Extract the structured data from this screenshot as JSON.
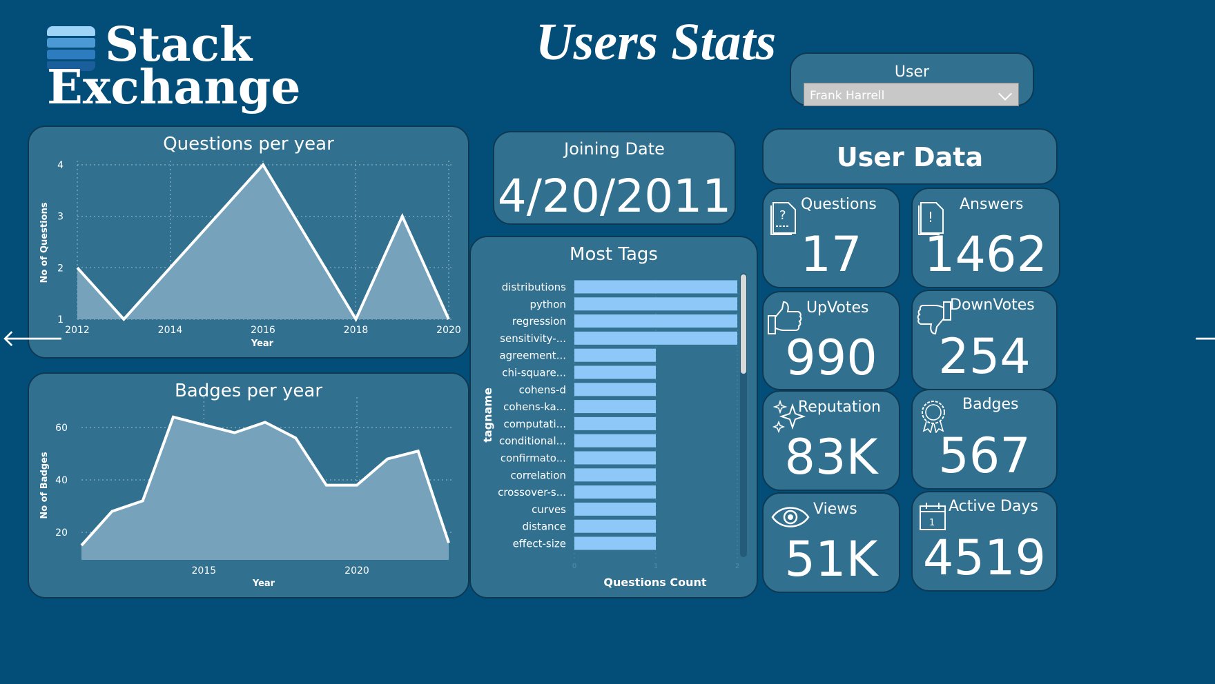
{
  "header": {
    "logo_line1": "Stack",
    "logo_line2": "Exchange",
    "title": "Users Stats"
  },
  "slicer": {
    "label": "User",
    "selected": "Frank Harrell"
  },
  "joining": {
    "label": "Joining Date",
    "value": "4/20/2011"
  },
  "user_data": {
    "title": "User Data",
    "kpis": {
      "questions": {
        "label": "Questions",
        "value": "17",
        "icon": "question-doc-icon"
      },
      "answers": {
        "label": "Answers",
        "value": "1462",
        "icon": "exclamation-doc-icon"
      },
      "upvotes": {
        "label": "UpVotes",
        "value": "990",
        "icon": "thumbs-up-icon"
      },
      "downvotes": {
        "label": "DownVotes",
        "value": "254",
        "icon": "thumbs-down-icon"
      },
      "reputation": {
        "label": "Reputation",
        "value": "83K",
        "icon": "sparkle-icon"
      },
      "badges": {
        "label": "Badges",
        "value": "567",
        "icon": "badge-ribbon-icon"
      },
      "views": {
        "label": "Views",
        "value": "51K",
        "icon": "eye-icon"
      },
      "active_days": {
        "label": "Active Days",
        "value": "4519",
        "icon": "calendar-icon"
      }
    }
  },
  "nav": {
    "prev": "🡐",
    "next": "🡒"
  },
  "colors": {
    "background": "#034e78",
    "card": "#31708f",
    "bar": "#8ec8f8",
    "area_fill": "#76a2bb"
  },
  "chart_data": [
    {
      "id": "questions_per_year",
      "type": "area",
      "title": "Questions per year",
      "xlabel": "Year",
      "ylabel": "No of Questions",
      "x": [
        2012,
        2013,
        2014,
        2015,
        2016,
        2017,
        2018,
        2019,
        2020
      ],
      "values": [
        2,
        1,
        2,
        3,
        4,
        2.5,
        1,
        3,
        1
      ],
      "xticks": [
        "2012",
        "2014",
        "2016",
        "2018",
        "2020"
      ],
      "yticks": [
        "1",
        "2",
        "3",
        "4"
      ],
      "xlim": [
        2012,
        2020
      ],
      "ylim": [
        1,
        4
      ],
      "grid": true
    },
    {
      "id": "badges_per_year",
      "type": "area",
      "title": "Badges per year",
      "xlabel": "Year",
      "ylabel": "No of Badges",
      "x": [
        2011,
        2012,
        2013,
        2014,
        2015,
        2016,
        2017,
        2018,
        2019,
        2020,
        2021,
        2022,
        2023
      ],
      "values": [
        15,
        28,
        32,
        64,
        61,
        58,
        62,
        56,
        38,
        38,
        48,
        51,
        16
      ],
      "xticks": [
        "2015",
        "2020"
      ],
      "yticks": [
        "20",
        "40",
        "60"
      ],
      "xlim": [
        2011,
        2023
      ],
      "ylim": [
        10,
        70
      ],
      "grid": true
    },
    {
      "id": "most_tags",
      "type": "bar",
      "orientation": "horizontal",
      "title": "Most Tags",
      "xlabel": "Questions Count",
      "ylabel": "tagname",
      "categories": [
        "distributions",
        "python",
        "regression",
        "sensitivity-...",
        "agreement...",
        "chi-square...",
        "cohens-d",
        "cohens-ka...",
        "computati...",
        "conditional...",
        "confirmato...",
        "correlation",
        "crossover-s...",
        "curves",
        "distance",
        "effect-size"
      ],
      "values": [
        2,
        2,
        2,
        2,
        1,
        1,
        1,
        1,
        1,
        1,
        1,
        1,
        1,
        1,
        1,
        1
      ],
      "xticks": [
        "0",
        "1",
        "2"
      ],
      "xlim": [
        0,
        2
      ]
    }
  ]
}
